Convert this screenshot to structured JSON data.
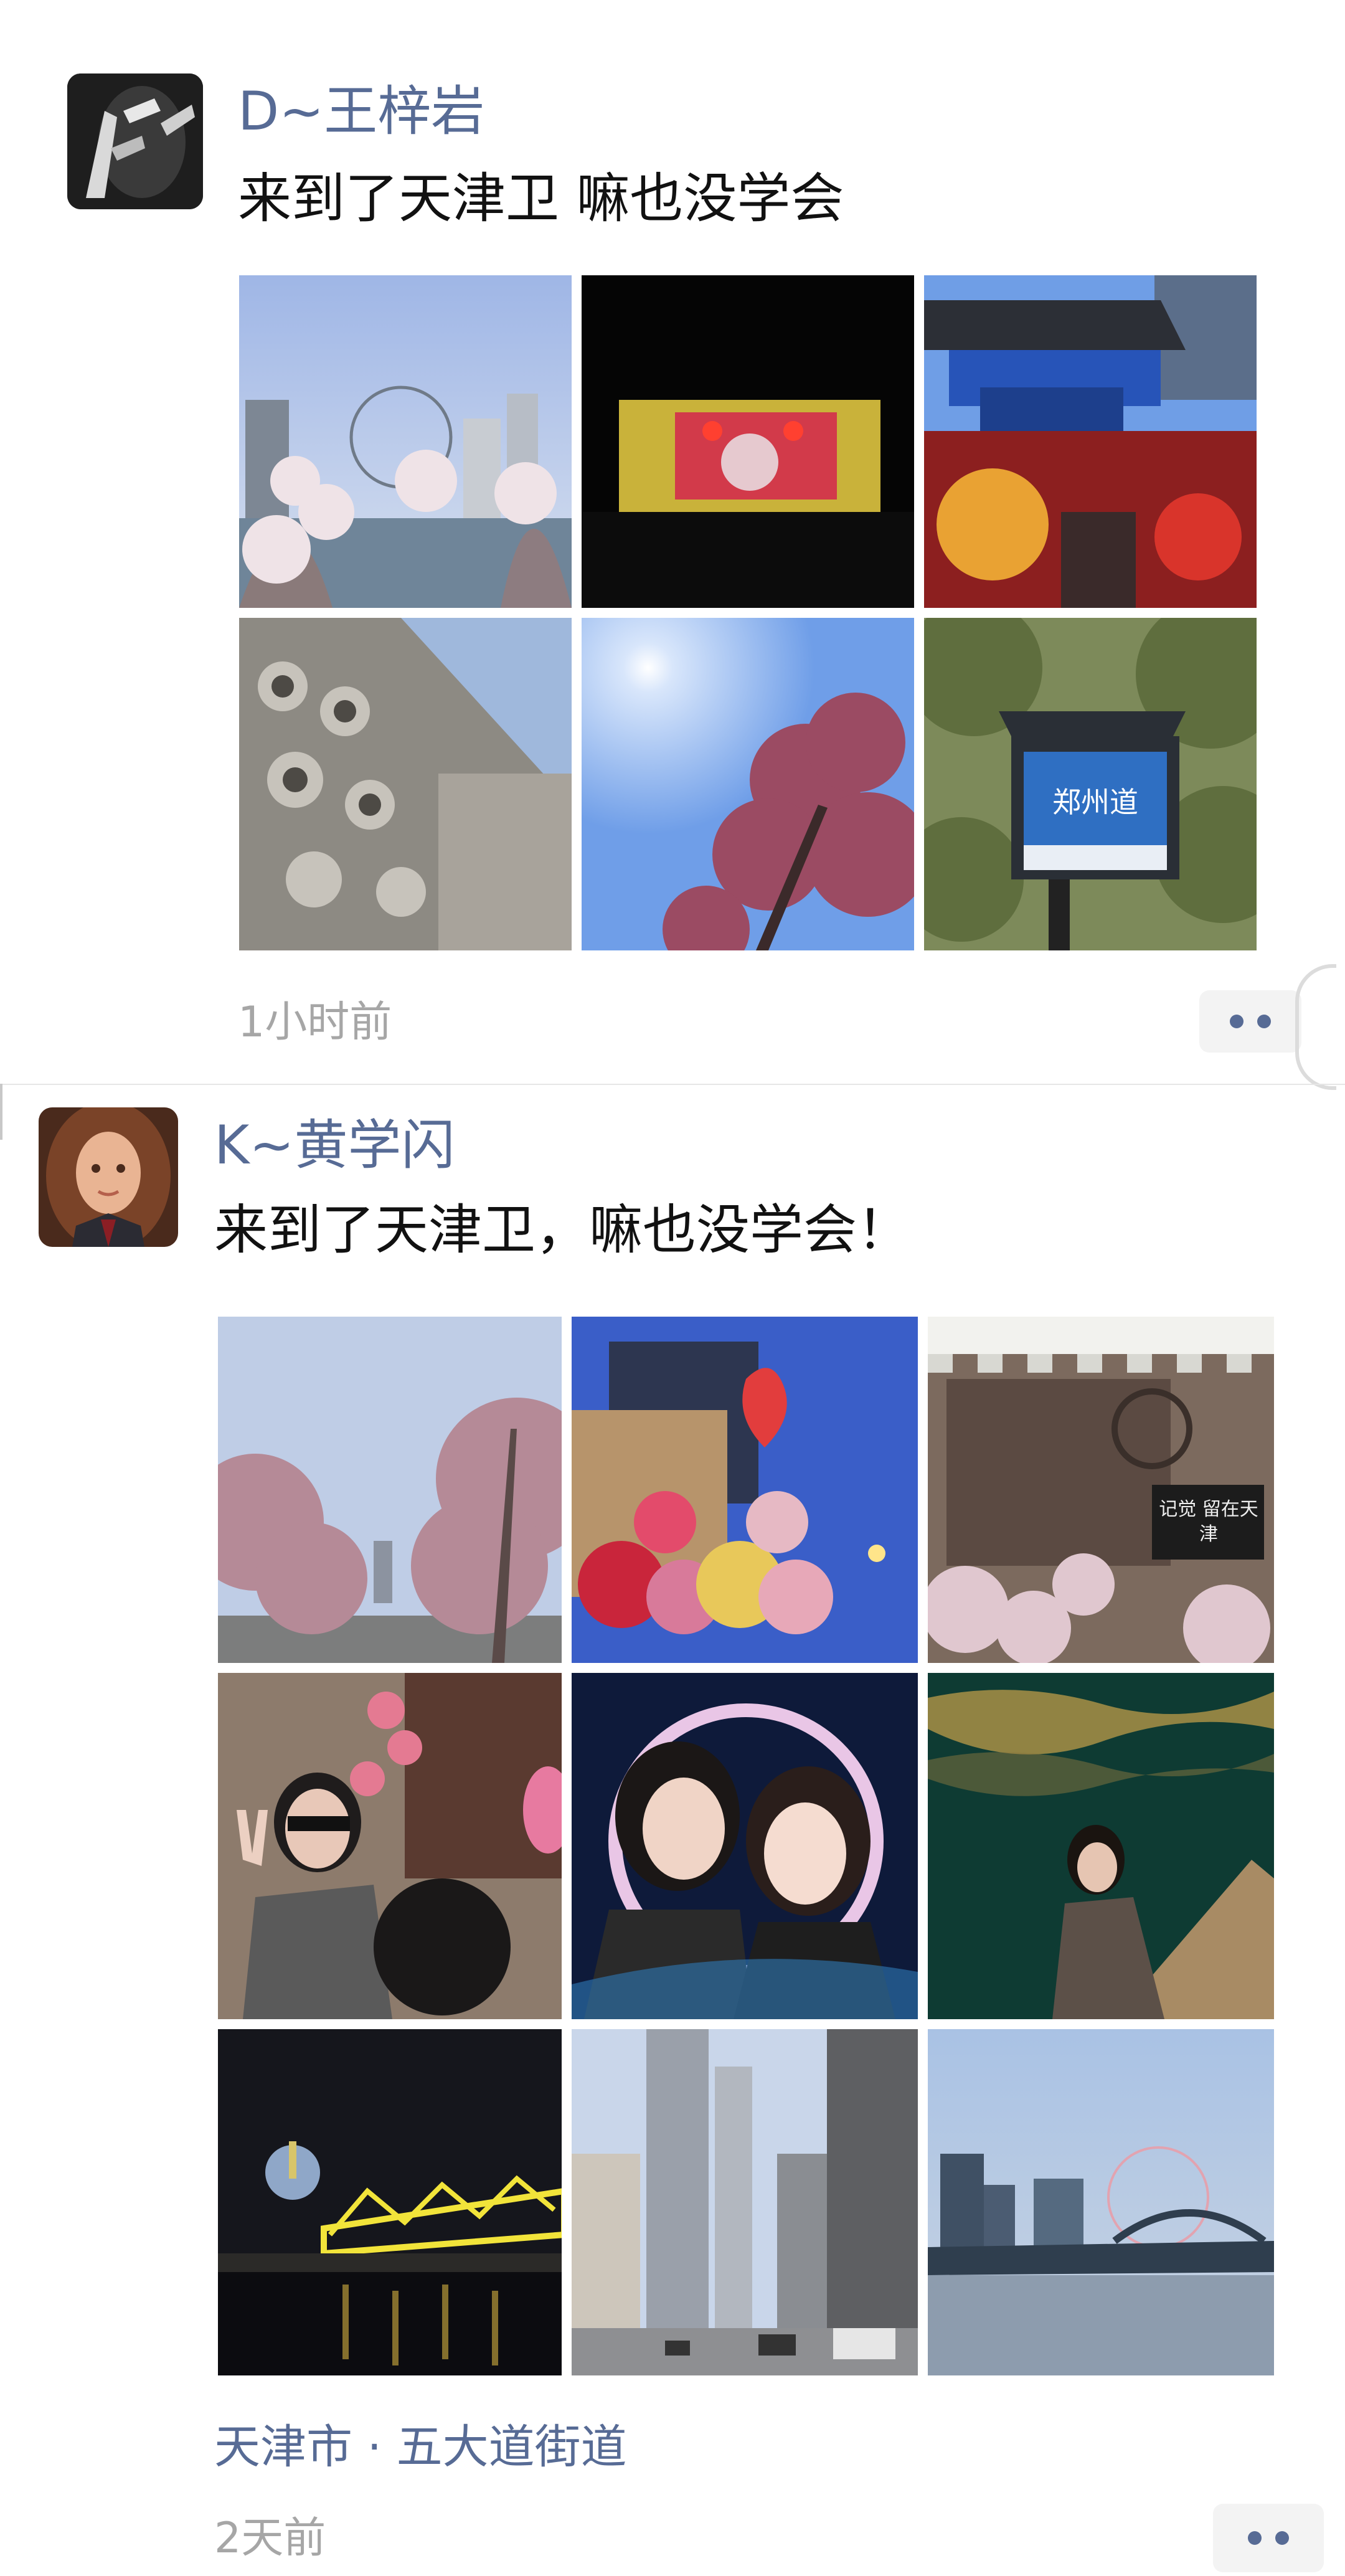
{
  "posts": [
    {
      "author": "D~王梓岩",
      "text": "来到了天津卫 嘛也没学会",
      "time": "1小时前",
      "location": "",
      "photos": [
        {
          "icon": "ferris-wheel-river-photo"
        },
        {
          "icon": "stage-performance-photo"
        },
        {
          "icon": "archway-gate-photo"
        },
        {
          "icon": "porcelain-house-photo"
        },
        {
          "icon": "blossom-sky-photo"
        },
        {
          "icon": "street-sign-photo",
          "sign_text": "郑州道"
        }
      ]
    },
    {
      "author": "K~黄学闪",
      "text": "来到了天津卫，嘛也没学会！",
      "time": "2天前",
      "location": "天津市 · 五大道街道",
      "photos": [
        {
          "icon": "blossom-avenue-photo"
        },
        {
          "icon": "balloon-stall-photo"
        },
        {
          "icon": "flower-shop-photo",
          "sign_text": "记觉 留在天津"
        },
        {
          "icon": "selfie-peace-sign-photo"
        },
        {
          "icon": "two-girls-photo"
        },
        {
          "icon": "riverside-portrait-photo"
        },
        {
          "icon": "night-bridge-photo"
        },
        {
          "icon": "city-street-photo"
        },
        {
          "icon": "river-ferris-wheel-photo"
        }
      ]
    }
  ],
  "colors": {
    "name": "#576b95",
    "text": "#111111",
    "time": "#a6a6a6",
    "more_bg": "#f3f3f3"
  }
}
